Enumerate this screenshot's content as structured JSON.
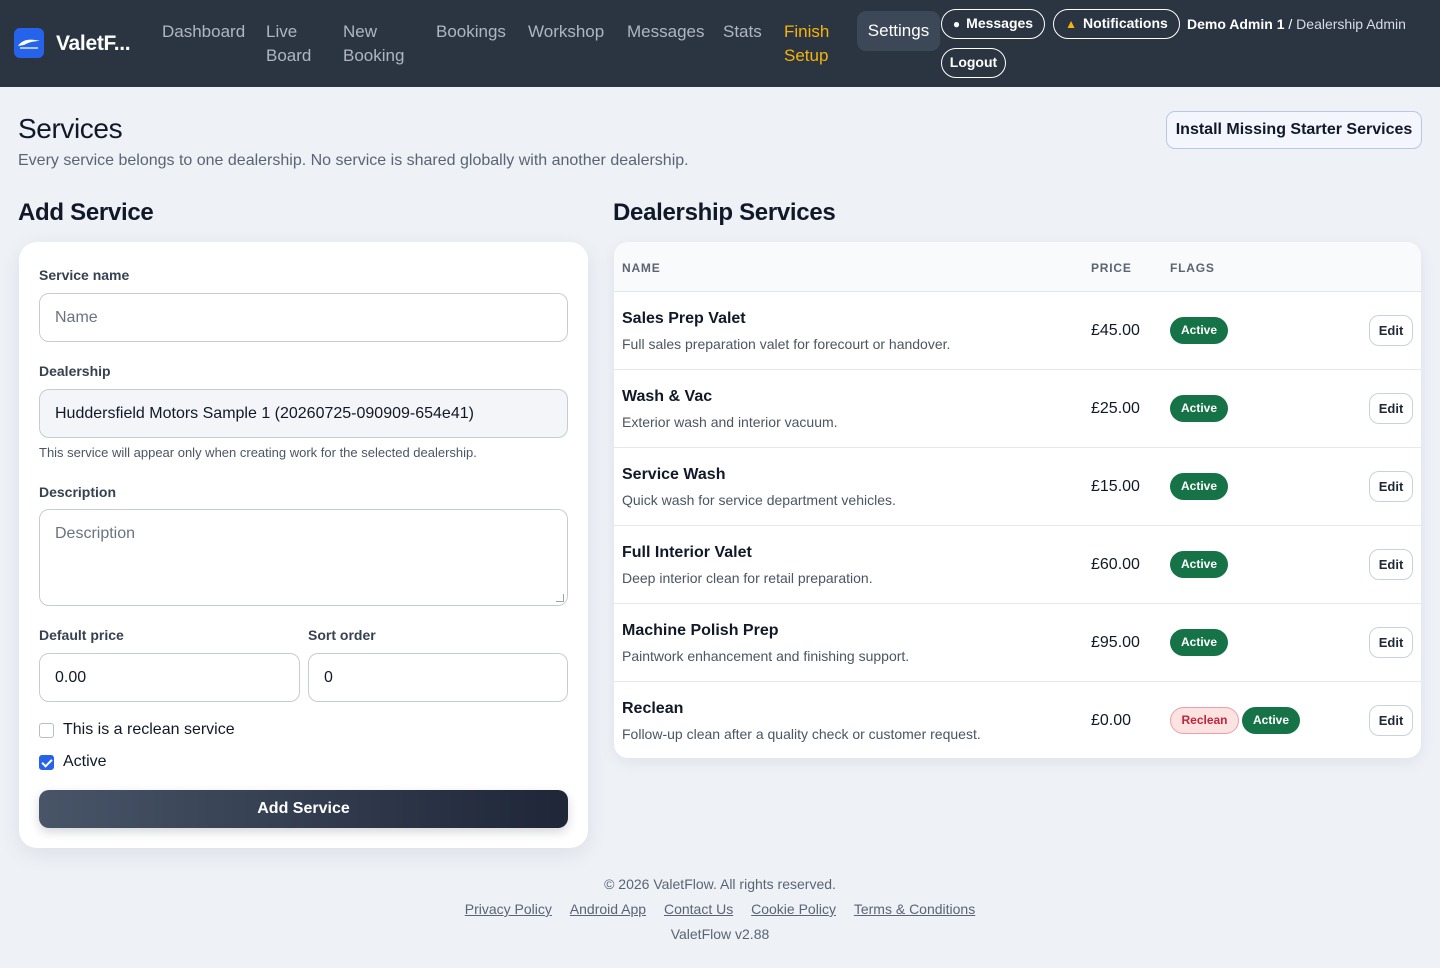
{
  "nav": {
    "brand": "ValetF...",
    "links": [
      {
        "line1": "Dashboard",
        "line2": ""
      },
      {
        "line1": "Live",
        "line2": "Board"
      },
      {
        "line1": "New",
        "line2": "Booking"
      },
      {
        "line1": "Bookings",
        "line2": ""
      },
      {
        "line1": "Workshop",
        "line2": ""
      },
      {
        "line1": "Messages",
        "line2": ""
      },
      {
        "line1": "Stats",
        "line2": ""
      },
      {
        "line1": "Finish",
        "line2": "Setup"
      }
    ],
    "settings": "Settings",
    "messages_btn": "Messages",
    "notifications_btn": "Notifications",
    "user_name": "Demo Admin 1",
    "user_sep": " / ",
    "user_role": "Dealership Admin",
    "logout": "Logout",
    "colors": {
      "background": "#2b3441",
      "finish_setup": "#f5b40b",
      "logo": "#2563eb"
    },
    "icons": {
      "logo": "car-logo-icon",
      "messages": "speech-bubble-icon",
      "notifications": "bell-icon"
    }
  },
  "header": {
    "title": "Services",
    "subtitle": "Every service belongs to one dealership. No service is shared globally with another dealership.",
    "install_button": "Install Missing Starter Services"
  },
  "form": {
    "section_title": "Add Service",
    "name_label": "Service name",
    "name_placeholder": "Name",
    "dealership_label": "Dealership",
    "dealership_value": "Huddersfield Motors Sample 1 (20260725-090909-654e41)",
    "dealership_hint": "This service will appear only when creating work for the selected dealership.",
    "description_label": "Description",
    "description_placeholder": "Description",
    "price_label": "Default price",
    "price_value": "0.00",
    "sort_label": "Sort order",
    "sort_value": "0",
    "reclean_label": "This is a reclean service",
    "reclean_checked": false,
    "active_label": "Active",
    "active_checked": true,
    "submit": "Add Service"
  },
  "services": {
    "section_title": "Dealership Services",
    "columns": [
      "NAME",
      "PRICE",
      "FLAGS"
    ],
    "edit_label": "Edit",
    "active_badge": "Active",
    "reclean_badge": "Reclean",
    "rows": [
      {
        "name": "Sales Prep Valet",
        "description": "Full sales preparation valet for forecourt or handover.",
        "price": "£45.00",
        "reclean": false,
        "active": true
      },
      {
        "name": "Wash & Vac",
        "description": "Exterior wash and interior vacuum.",
        "price": "£25.00",
        "reclean": false,
        "active": true
      },
      {
        "name": "Service Wash",
        "description": "Quick wash for service department vehicles.",
        "price": "£15.00",
        "reclean": false,
        "active": true
      },
      {
        "name": "Full Interior Valet",
        "description": "Deep interior clean for retail preparation.",
        "price": "£60.00",
        "reclean": false,
        "active": true
      },
      {
        "name": "Machine Polish Prep",
        "description": "Paintwork enhancement and finishing support.",
        "price": "£95.00",
        "reclean": false,
        "active": true
      },
      {
        "name": "Reclean",
        "description": "Follow-up clean after a quality check or customer request.",
        "price": "£0.00",
        "reclean": true,
        "active": true
      }
    ],
    "colors": {
      "active": "#157347",
      "reclean_bg": "#fde2e2",
      "reclean_text": "#c0263a"
    }
  },
  "footer": {
    "copyright": "© 2026 ValetFlow. All rights reserved.",
    "links": [
      "Privacy Policy",
      "Android App",
      "Contact Us",
      "Cookie Policy",
      "Terms & Conditions"
    ],
    "version": "ValetFlow v2.88"
  }
}
